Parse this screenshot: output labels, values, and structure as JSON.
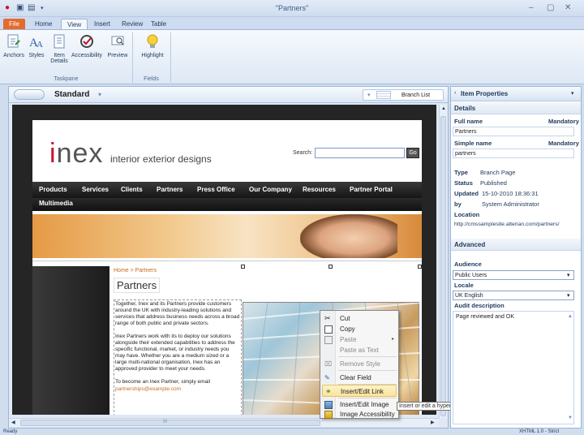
{
  "window": {
    "title": "\"Partners\""
  },
  "ribbon": {
    "tabs": [
      "File",
      "Home",
      "View",
      "Insert",
      "Review",
      "Table"
    ],
    "active_tab": "View",
    "buttons": {
      "anchors": "Anchors",
      "styles": "Styles",
      "item_details_1": "Item",
      "item_details_2": "Details",
      "accessibility": "Accessibility",
      "preview": "Preview",
      "highlight": "Highlight"
    },
    "groups": {
      "taskpane": "Taskpane",
      "fields": "Fields"
    }
  },
  "doc": {
    "template": "Standard",
    "branch_list": "Branch List",
    "hscroll_label": "III"
  },
  "site": {
    "logo_letter_i": "i",
    "logo_rest": "nex",
    "tagline": "interior exterior designs",
    "search_label": "Search:",
    "search_button": "Go",
    "nav": [
      "Products",
      "Services",
      "Clients",
      "Partners",
      "Press Office",
      "Our Company",
      "Resources",
      "Partner Portal"
    ],
    "nav2": "Multimedia",
    "breadcrumb": "Home > Partners",
    "heading": "Partners",
    "para1": "Together, Inex and its Partners provide customers around the UK with industry-leading solutions and services that address business needs across a broad range of both public and private sectors.",
    "para2": "Inex Partners work with its to deploy our solutions alongside their extended capabilities to address the specific functional, market, or industry needs you may have. Whether you are a medium sized or a large multi-national organisation, Inex has an approved provider to meet your needs.",
    "para3": "To become an Inex Partner, simply email",
    "email": "partnerships@example.com"
  },
  "context_menu": {
    "items": [
      {
        "label": "Cut",
        "disabled": false
      },
      {
        "label": "Copy",
        "disabled": false
      },
      {
        "label": "Paste",
        "disabled": true
      },
      {
        "label": "Paste as Text",
        "disabled": true
      },
      {
        "label": "Remove Style",
        "disabled": true
      },
      {
        "label": "Clear Field",
        "disabled": false
      },
      {
        "label": "Insert/Edit Link",
        "disabled": false
      },
      {
        "label": "Insert/Edit Image",
        "disabled": false
      },
      {
        "label": "Image Accessibility",
        "disabled": false
      }
    ],
    "tooltip": "Insert or edit a hyperlink"
  },
  "props": {
    "header": "Item Properties",
    "details_title": "Details",
    "full_name_label": "Full name",
    "mandatory": "Mandatory",
    "full_name_value": "Partners",
    "simple_name_label": "Simple name",
    "simple_name_value": "partners",
    "type_label": "Type",
    "type_value": "Branch Page",
    "status_label": "Status",
    "status_value": "Published",
    "updated_label": "Updated",
    "updated_value": "15-10-2010 18:36:31",
    "by_label": "by",
    "by_value": "System Administrator",
    "location_label": "Location",
    "location_value": "http://cmssamplesite.alterian.com/partners/",
    "advanced_title": "Advanced",
    "audience_label": "Audience",
    "audience_value": "Public Users",
    "locale_label": "Locale",
    "locale_value": "UK English",
    "audit_label": "Audit description",
    "audit_value": "Page reviewed and OK"
  },
  "status": {
    "left": "Ready",
    "right": "XHTML 1.0 - Strict"
  }
}
